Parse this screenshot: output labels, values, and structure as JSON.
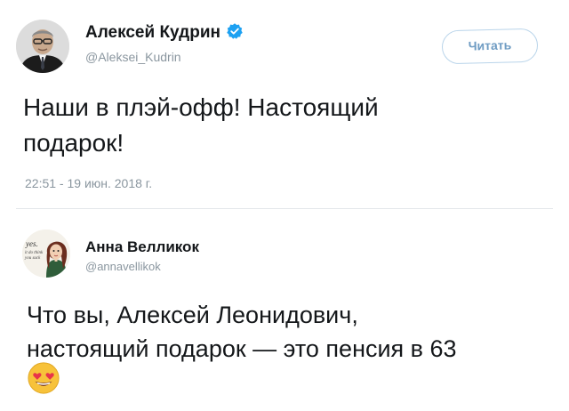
{
  "tweet": {
    "author_name": "Алексей Кудрин",
    "author_handle": "@Aleksei_Kudrin",
    "verified": true,
    "follow_label": "Читать",
    "text_line1": "Наши в плэй-офф! Настоящий",
    "text_line2": "подарок!",
    "timestamp": "22:51 - 19 июн. 2018 г."
  },
  "reply": {
    "author_name": "Анна Велликок",
    "author_handle": "@annavellikok",
    "text_line1": "Что вы, Алексей Леонидович,",
    "text_line2": "настоящий подарок — это пенсия в 63",
    "emoji": "heart-eyes-emoji"
  },
  "colors": {
    "verified_blue": "#1da1f2",
    "follow_border": "#b9d4ea",
    "follow_text": "#6f9cc3",
    "meta_gray": "#8a969f"
  }
}
